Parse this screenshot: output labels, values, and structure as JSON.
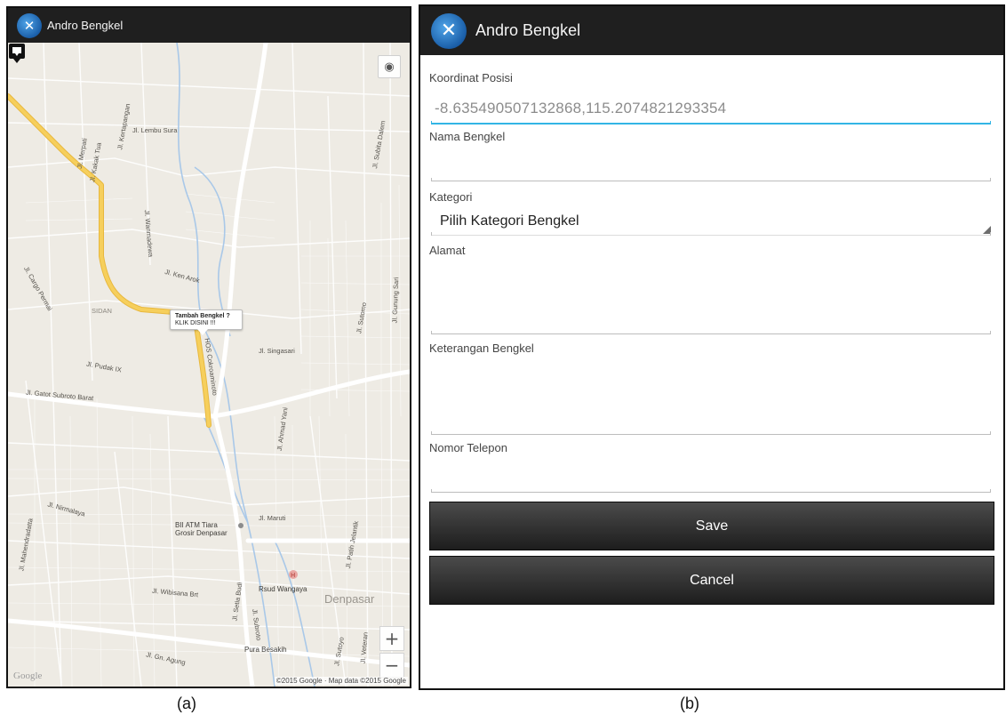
{
  "panel_a": {
    "app_title": "Andro Bengkel",
    "app_icon": "wrench-hammer-globe-icon",
    "map": {
      "infowindow_title": "Tambah Bengkel ?",
      "infowindow_text": "KLIK DISINI !!!",
      "street_labels": [
        "Jl. Lembu Sura",
        "Jl. Kertapangan",
        "Jl. Merpati",
        "Jl. Kakak Tua",
        "Jl. Wanmadewa",
        "Jl. Ken Arok",
        "Jl. Cargo Permai",
        "SIDAN",
        "Jl. Pudak IX",
        "Jl. Singasari",
        "Jl. Sutomo",
        "Jl. Gunung Sari",
        "Jl. Gatot Subroto Barat",
        "HOS Cokroaminoto",
        "Jl. Ahmad Yani",
        "Jl. Nirmalaya",
        "Jl. Mahendradatta",
        "Jl. Maruti",
        "Jl. Wibisana Brt",
        "Jl. Setia Budi",
        "Jl. Subroto",
        "Jl. Gn. Agung",
        "Jl. Sutoyo",
        "Jl. Veteran",
        "Jl. Patih Jelantik",
        "Jl. Subita Dalem"
      ],
      "poi_labels": [
        "BII ATM Tiara Grosir Denpasar",
        "Rsud Wangaya",
        "Pura Besakih"
      ],
      "city_label": "Denpasar",
      "zoom_in": "+",
      "zoom_out": "−",
      "google_logo": "Google",
      "attribution": "©2015 Google · Map data ©2015 Google"
    }
  },
  "panel_b": {
    "app_title": "Andro Bengkel",
    "app_icon": "wrench-hammer-globe-icon",
    "form": {
      "coord_label": "Koordinat Posisi",
      "coord_value": "-8.635490507132868,115.2074821293354",
      "name_label": "Nama Bengkel",
      "name_value": "",
      "category_label": "Kategori",
      "category_value": "Pilih Kategori Bengkel",
      "address_label": "Alamat",
      "address_value": "",
      "notes_label": "Keterangan Bengkel",
      "notes_value": "",
      "phone_label": "Nomor Telepon",
      "phone_value": "",
      "save_label": "Save",
      "cancel_label": "Cancel"
    }
  },
  "captions": {
    "a": "(a)",
    "b": "(b)"
  },
  "colors": {
    "actionbar": "#1f1f1f",
    "focus_underline": "#33b5e5",
    "main_road": "#f6cf5c",
    "map_bg": "#eeebe4"
  }
}
